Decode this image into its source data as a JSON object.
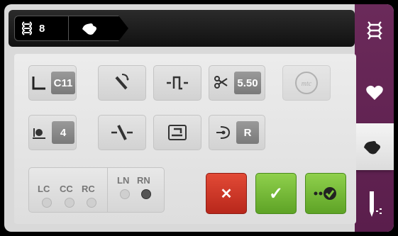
{
  "header": {
    "stitch_number": "8"
  },
  "tiles": {
    "stitch_length_value": "C11",
    "stitch_width_value": "5.50",
    "tension_value": "4",
    "needle_stop_value": "R",
    "mtc_label": "mtc"
  },
  "lights": {
    "labels": [
      "LC",
      "CC",
      "RC"
    ],
    "needle_labels": [
      "LN",
      "RN"
    ],
    "rn_active": true
  },
  "buttons": {
    "cancel": "✕",
    "confirm": "✓"
  },
  "colors": {
    "tab_strip": "#5a1e4c",
    "cancel_red": "#c8301f",
    "confirm_green": "#6cb52f"
  },
  "icons": [
    "stitch-icon",
    "hand-icon",
    "heart-icon",
    "needle-icon",
    "foot-icon",
    "scissors-icon",
    "mtc-icon"
  ]
}
